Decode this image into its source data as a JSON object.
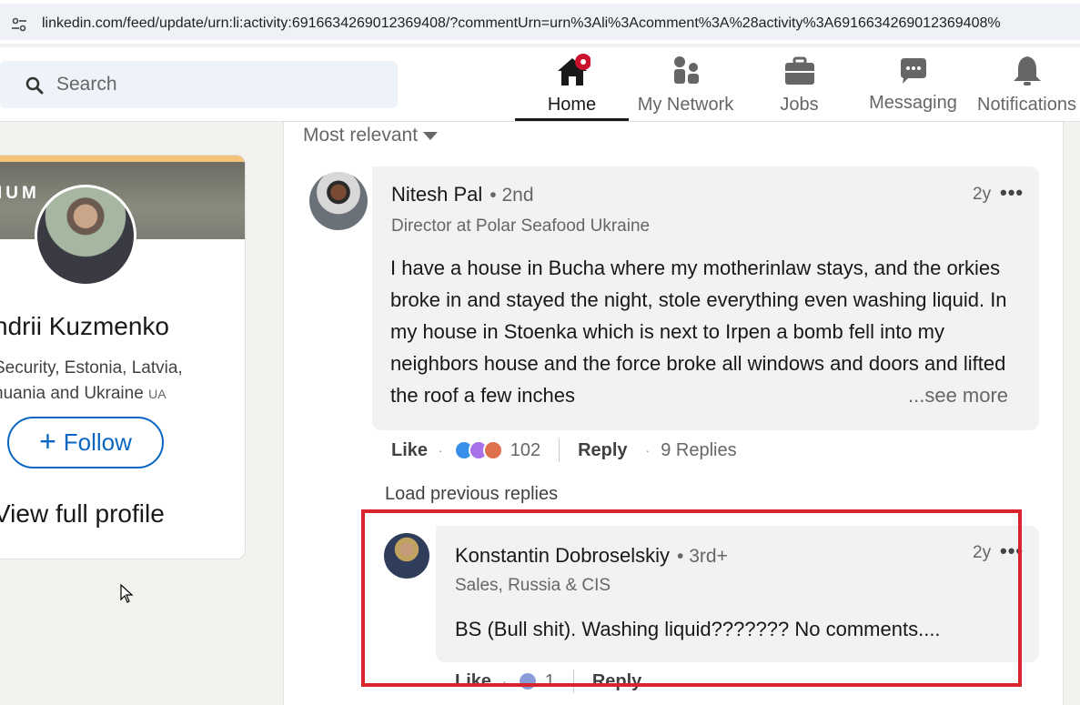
{
  "browser": {
    "url": "linkedin.com/feed/update/urn:li:activity:6916634269012369408/?commentUrn=urn%3Ali%3Acomment%3A%28activity%3A6916634269012369408%"
  },
  "nav": {
    "search_placeholder": "Search",
    "items": [
      {
        "label": "Home",
        "icon": "home-icon",
        "active": true
      },
      {
        "label": "My Network",
        "icon": "network-icon"
      },
      {
        "label": "Jobs",
        "icon": "briefcase-icon"
      },
      {
        "label": "Messaging",
        "icon": "chat-icon"
      },
      {
        "label": "Notifications",
        "icon": "bell-icon"
      }
    ]
  },
  "profile_card": {
    "badge": "IUM",
    "name": "ndrii Kuzmenko",
    "headline_line1": "Security, Estonia, Latvia,",
    "headline_line2": "huania and Ukraine",
    "headline_lang": "UA",
    "follow_label": "Follow",
    "view_profile_label": "View full profile"
  },
  "feed": {
    "sort_label": "Most relevant",
    "comments": [
      {
        "author": "Nitesh Pal",
        "degree": "• 2nd",
        "headline": "Director at Polar Seafood Ukraine",
        "time": "2y",
        "more": "•••",
        "text": "I have a house in Bucha where my motherinlaw stays, and the orkies broke in and stayed the night, stole everything even washing liquid. In my house in Stoenka which is next to Irpen a bomb fell into my neighbors house and the force broke all windows and doors and lifted the roof a few inches",
        "see_more": "...see more",
        "like_label": "Like",
        "reaction_count": "102",
        "reply_label": "Reply",
        "replies_label": "9 Replies"
      }
    ],
    "load_previous_label": "Load previous replies",
    "reply": {
      "author": "Konstantin Dobroselskiy",
      "degree": "• 3rd+",
      "headline": "Sales, Russia & CIS",
      "time": "2y",
      "more": "•••",
      "text": "BS (Bull shit). Washing liquid??????? No comments....",
      "like_label": "Like",
      "reaction_count": "1",
      "reply_label": "Reply"
    }
  },
  "colors": {
    "linkedin_blue": "#0a66c2",
    "highlight_red": "#d7242f",
    "notification_badge": "#cb112d"
  }
}
